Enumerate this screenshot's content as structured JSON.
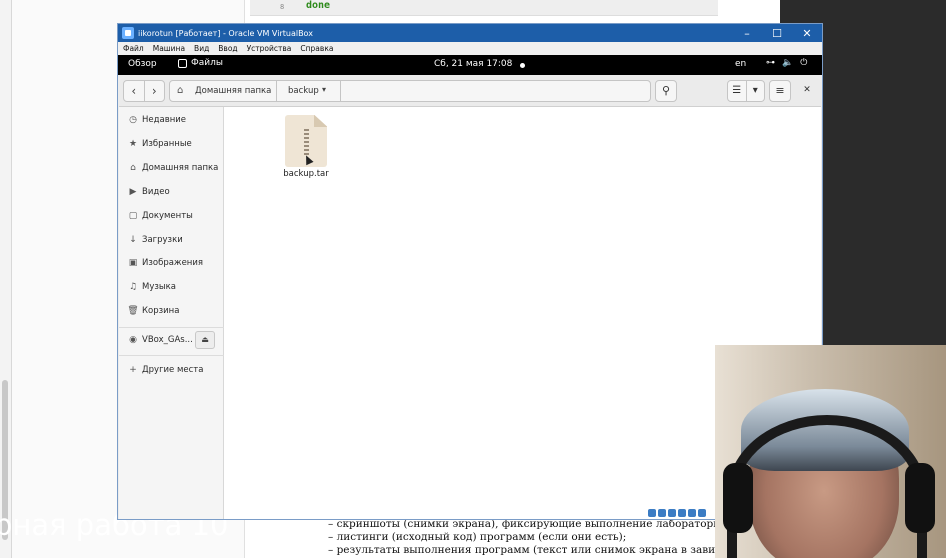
{
  "host": {
    "code_line_number": "8",
    "code_keyword": "done",
    "lab_title": "рная работа 10",
    "doc_bullets": [
      "–  скриншоты (снимки экрана), фиксирующие выполнение лабораторной работы",
      "–  листинги (исходный код) программ (если они есть);",
      "–  результаты выполнения программ (текст или снимок экрана в зависимости о"
    ]
  },
  "vbox": {
    "title": "iikorotun [Работает] - Oracle VM VirtualBox",
    "minimize": "–",
    "maximize": "☐",
    "close": "✕",
    "menu": [
      "Файл",
      "Машина",
      "Вид",
      "Ввод",
      "Устройства",
      "Справка"
    ]
  },
  "gnome": {
    "overview": "Обзор",
    "app_name": "Файлы",
    "clock": "Сб, 21 мая  17:08",
    "lang": "en",
    "tray_network": "⊶",
    "tray_volume": "🔈",
    "tray_power": "⏻"
  },
  "nautilus": {
    "back": "‹",
    "forward": "›",
    "home_icon": "⌂",
    "home_label": "Домашняя папка",
    "current_folder": "backup",
    "dropdown": "▾",
    "search_icon": "⚲",
    "list_view_icon": "☰",
    "view_options": "▾",
    "menu_icon": "≡",
    "close": "✕",
    "sidebar": [
      {
        "icon": "◷",
        "label": "Недавние"
      },
      {
        "icon": "★",
        "label": "Избранные"
      },
      {
        "icon": "⌂",
        "label": "Домашняя папка"
      },
      {
        "icon": "▶",
        "label": "Видео"
      },
      {
        "icon": "▢",
        "label": "Документы"
      },
      {
        "icon": "↓",
        "label": "Загрузки"
      },
      {
        "icon": "▣",
        "label": "Изображения"
      },
      {
        "icon": "♫",
        "label": "Музыка"
      },
      {
        "icon": "🗑",
        "label": "Корзина"
      }
    ],
    "device": {
      "icon": "◉",
      "label": "VBox_GAs...",
      "eject": "⏏"
    },
    "other_places": {
      "icon": "+",
      "label": "Другие места"
    },
    "files": [
      {
        "name": "backup.tar",
        "type": "archive"
      }
    ]
  }
}
